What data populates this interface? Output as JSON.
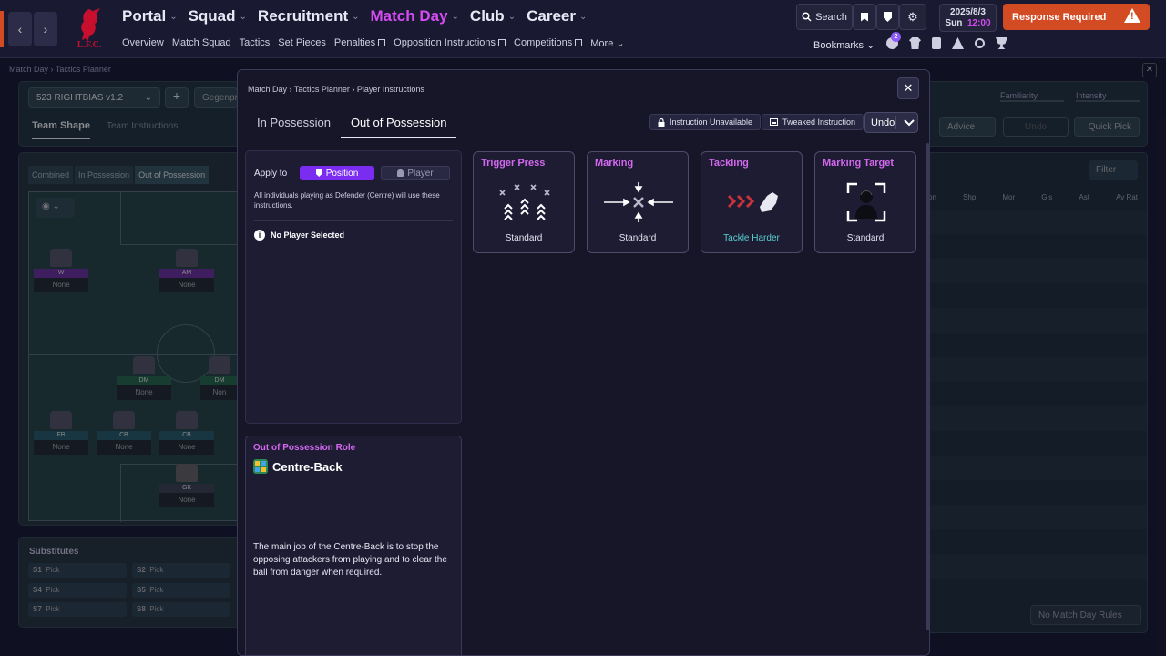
{
  "header": {
    "nav": [
      {
        "label": "Portal"
      },
      {
        "label": "Squad"
      },
      {
        "label": "Recruitment"
      },
      {
        "label": "Match Day"
      },
      {
        "label": "Club"
      },
      {
        "label": "Career"
      }
    ],
    "subnav": [
      "Overview",
      "Match Squad",
      "Tactics",
      "Set Pieces",
      "Penalties",
      "Opposition Instructions",
      "Competitions",
      "More"
    ],
    "search_label": "Search",
    "date": "2025/8/3",
    "day": "Sun",
    "time": "12:00",
    "response_label": "Response Required",
    "bookmarks_label": "Bookmarks",
    "badge_count": "2",
    "club_badge": "L.F.C.",
    "accent": "#d34cf0",
    "response_color": "#d24b22"
  },
  "background": {
    "breadcrumb": [
      "Match Day",
      "Tactics Planner"
    ],
    "tactic_name": "523 RIGHTBIAS v1.2",
    "tactic_extra": "Gegenpr",
    "familiarity": "Familiarity",
    "intensity": "Intensity",
    "team_shape": "Team Shape",
    "team_instructions": "Team Instructions",
    "advice": "Advice",
    "undo": "Undo",
    "quick_pick": "Quick Pick",
    "view_tabs": [
      "Combined",
      "In Possession",
      "Out of Possession"
    ],
    "filter": "Filter",
    "columns": [
      "on",
      "Shp",
      "Mor",
      "Gls",
      "Ast",
      "Av Rat"
    ],
    "positions": [
      {
        "label": "W",
        "name": "None"
      },
      {
        "label": "AM",
        "name": "None"
      },
      {
        "label": "DM",
        "name": "None"
      },
      {
        "label": "DM",
        "name": "Non"
      },
      {
        "label": "FB",
        "name": "None"
      },
      {
        "label": "CB",
        "name": "None"
      },
      {
        "label": "CB",
        "name": "None"
      },
      {
        "label": "GK",
        "name": "None"
      }
    ],
    "substitutes_title": "Substitutes",
    "subs": [
      {
        "slot": "S1",
        "val": "Pick"
      },
      {
        "slot": "S2",
        "val": "Pick"
      },
      {
        "slot": "S4",
        "val": "Pick"
      },
      {
        "slot": "S5",
        "val": "Pick"
      },
      {
        "slot": "S7",
        "val": "Pick"
      },
      {
        "slot": "S8",
        "val": "Pick"
      }
    ],
    "match_rules": "No Match Day Rules"
  },
  "modal": {
    "breadcrumb": [
      "Match Day",
      "Tactics Planner",
      "Player Instructions"
    ],
    "tabs": [
      "In Possession",
      "Out of Possession"
    ],
    "legend_unavailable": "Instruction Unavailable",
    "legend_tweaked": "Tweaked Instruction",
    "undo_label": "Undo",
    "apply_to_label": "Apply to",
    "position_toggle": "Position",
    "player_toggle": "Player",
    "apply_desc": "All individuals playing as Defender (Centre) will use these instructions.",
    "no_player": "No Player Selected",
    "role_section_title": "Out of Possession Role",
    "role_name": "Centre-Back",
    "role_desc": "The main job of the Centre-Back is to stop the opposing attackers from playing and to clear the ball from danger when required.",
    "cards": [
      {
        "title": "Trigger Press",
        "value": "Standard",
        "icon": "trigger-press-icon"
      },
      {
        "title": "Marking",
        "value": "Standard",
        "icon": "marking-icon"
      },
      {
        "title": "Tackling",
        "value": "Tackle Harder",
        "icon": "tackling-icon"
      },
      {
        "title": "Marking Target",
        "value": "Standard",
        "icon": "marking-target-icon"
      }
    ]
  }
}
